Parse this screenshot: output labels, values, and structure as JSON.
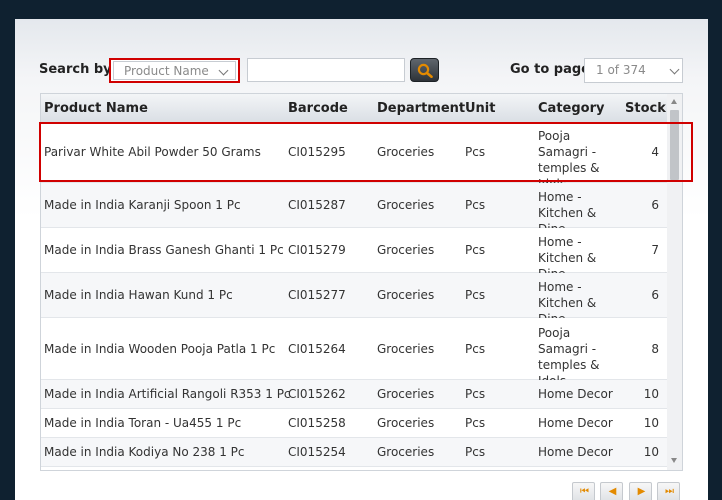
{
  "search": {
    "label": "Search by :",
    "field_selected": "Product Name",
    "query_value": "",
    "query_placeholder": ""
  },
  "goto": {
    "label": "Go to page",
    "page_selected": "1 of 374"
  },
  "table": {
    "headers": {
      "product_name": "Product Name",
      "barcode": "Barcode",
      "department": "Department",
      "unit": "Unit",
      "category": "Category",
      "stock": "Stock"
    },
    "rows": [
      {
        "product_name": "Parivar White Abil Powder 50 Grams",
        "barcode": "CI015295",
        "department": "Groceries",
        "unit": "Pcs",
        "category": "Pooja Samagri -temples & Idols",
        "stock": "4"
      },
      {
        "product_name": "Made in India Karanji Spoon 1 Pc",
        "barcode": "CI015287",
        "department": "Groceries",
        "unit": "Pcs",
        "category": "Home - Kitchen & Dine",
        "stock": "6"
      },
      {
        "product_name": "Made in India Brass Ganesh Ghanti 1 Pc",
        "barcode": "CI015279",
        "department": "Groceries",
        "unit": "Pcs",
        "category": "Home - Kitchen & Dine",
        "stock": "7"
      },
      {
        "product_name": "Made in India Hawan Kund 1 Pc",
        "barcode": "CI015277",
        "department": "Groceries",
        "unit": "Pcs",
        "category": "Home - Kitchen & Dine",
        "stock": "6"
      },
      {
        "product_name": "Made in India Wooden Pooja Patla 1 Pc",
        "barcode": "CI015264",
        "department": "Groceries",
        "unit": "Pcs",
        "category": "Pooja Samagri -temples & Idols",
        "stock": "8"
      },
      {
        "product_name": "Made in India Artificial Rangoli R353 1 Pc",
        "barcode": "CI015262",
        "department": "Groceries",
        "unit": "Pcs",
        "category": "Home Decor",
        "stock": "10"
      },
      {
        "product_name": "Made in India Toran - Ua455 1 Pc",
        "barcode": "CI015258",
        "department": "Groceries",
        "unit": "Pcs",
        "category": "Home Decor",
        "stock": "10"
      },
      {
        "product_name": "Made in India Kodiya No 238 1 Pc",
        "barcode": "CI015254",
        "department": "Groceries",
        "unit": "Pcs",
        "category": "Home Decor",
        "stock": "10"
      }
    ]
  },
  "pager": {
    "first": "⏮",
    "prev": "◀",
    "next": "▶",
    "last": "⏭"
  },
  "colors": {
    "highlight": "#d00000",
    "pager_icon": "#e38a00",
    "search_icon": "#e38a00"
  }
}
